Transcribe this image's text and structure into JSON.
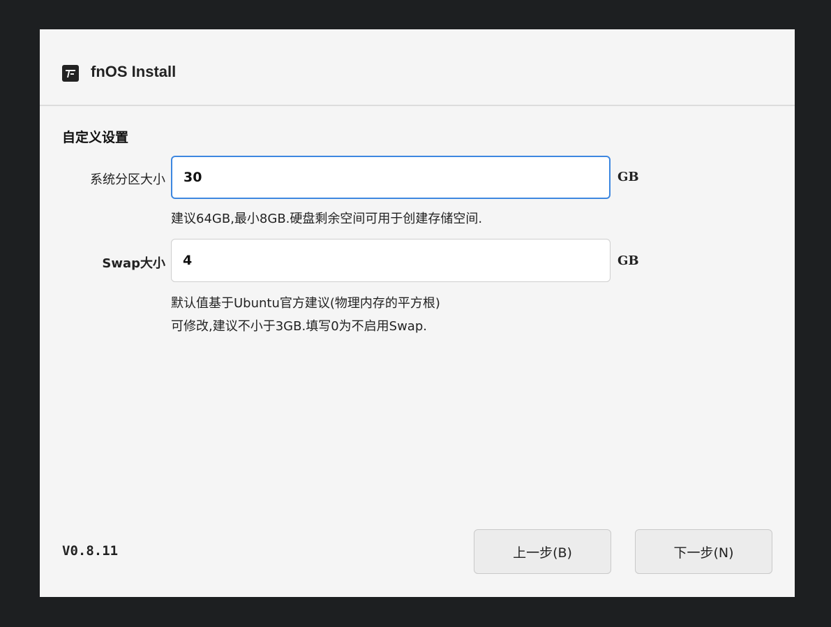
{
  "window": {
    "title": "fnOS Install",
    "icon": "fnos-logo-icon"
  },
  "section": {
    "title": "自定义设置"
  },
  "system_partition": {
    "label": "系统分区大小",
    "value": "30",
    "unit": "GB",
    "hint": "建议64GB,最小8GB.硬盘剩余空间可用于创建存储空间."
  },
  "swap": {
    "label": "Swap大小",
    "value": "4",
    "unit": "GB",
    "hint_line1": "默认值基于Ubuntu官方建议(物理内存的平方根)",
    "hint_line2": "可修改,建议不小于3GB.填写0为不启用Swap."
  },
  "footer": {
    "version": "V0.8.11",
    "back_label": "上一步(B)",
    "next_label": "下一步(N)"
  },
  "colors": {
    "background": "#1d1f21",
    "window": "#f5f5f5",
    "focus_border": "#3d87e0"
  }
}
